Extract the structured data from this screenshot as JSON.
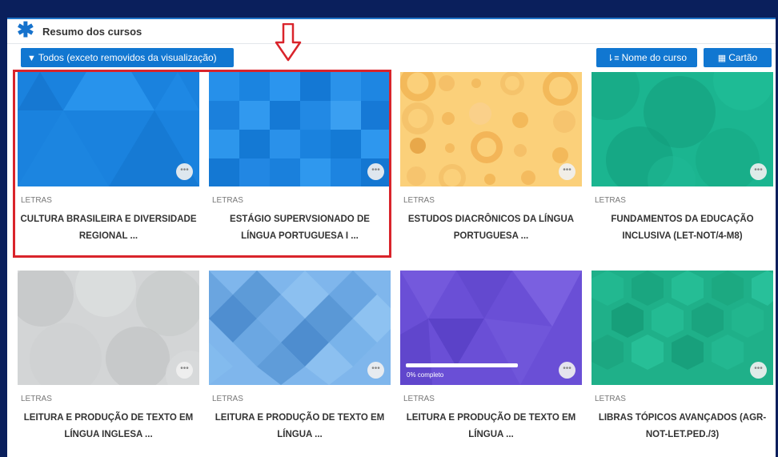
{
  "header": {
    "title": "Resumo dos cursos",
    "icon": "asterisk-icon"
  },
  "toolbar": {
    "filter_label": "Todos (exceto removidos da visualização)",
    "sort_label": "Nome do curso",
    "view_label": "Cartão"
  },
  "courses": [
    {
      "category": "LETRAS",
      "name1": "CULTURA BRASILEIRA E DIVERSIDADE",
      "name2": "REGIONAL ..."
    },
    {
      "category": "LETRAS",
      "name1": "ESTÁGIO SUPERVSIONADO DE",
      "name2": "LÍNGUA PORTUGUESA I ..."
    },
    {
      "category": "LETRAS",
      "name1": "ESTUDOS DIACRÔNICOS DA LÍNGUA",
      "name2": "PORTUGUESA ..."
    },
    {
      "category": "LETRAS",
      "name1": "FUNDAMENTOS DA EDUCAÇÃO",
      "name2": "INCLUSIVA (LET-NOT/4-M8)"
    },
    {
      "category": "LETRAS",
      "name1": "LEITURA E PRODUÇÃO DE TEXTO EM",
      "name2": "LÍNGUA INGLESA ..."
    },
    {
      "category": "LETRAS",
      "name1": "LEITURA E PRODUÇÃO DE TEXTO EM",
      "name2": "LÍNGUA ..."
    },
    {
      "category": "LETRAS",
      "name1": "LEITURA E PRODUÇÃO DE TEXTO EM",
      "name2": "LÍNGUA ...",
      "progress_label": "0% completo",
      "progress": 0
    },
    {
      "category": "LETRAS",
      "name1": "LIBRAS TÓPICOS AVANÇADOS (AGR-",
      "name2": "NOT-LET.PED./3)"
    }
  ],
  "colors": {
    "accent": "#1177d1",
    "highlight": "#d9242b",
    "background": "#0a1f5c"
  }
}
